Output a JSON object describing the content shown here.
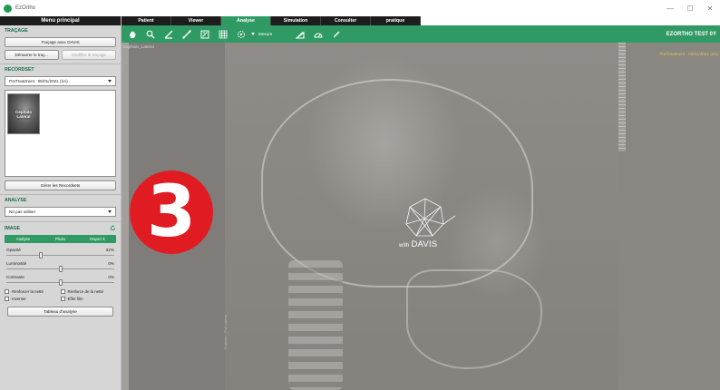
{
  "window": {
    "title": "EzOrtho",
    "controls": [
      "—",
      "☐",
      "✕"
    ]
  },
  "sidebar": {
    "header": "Menu principal",
    "tracage": {
      "title": "TRAÇAGE",
      "davis_button": "Traçage avec DAVIS",
      "start_button": "Démarrer le traç...",
      "modify_button": "Modifier le traçage"
    },
    "recordset": {
      "title": "RECORDSET",
      "selected": "PreTreatment : 05/01/2021 (I/A)",
      "thumbnail_label": "Cephalo Lateral",
      "manage_button": "Gérer les Recordsets"
    },
    "analyse": {
      "title": "ANALYSE",
      "selected": "Ne pas utiliser"
    },
    "image": {
      "title": "IMAGE",
      "segments": [
        "Analyse",
        "Photo",
        "Rayon X"
      ],
      "sliders": [
        {
          "label": "Opacité",
          "value_text": "32%",
          "level": 0.32
        },
        {
          "label": "Luminosité",
          "value_text": "0%",
          "level": 0.5
        },
        {
          "label": "Contraste",
          "value_text": "0%",
          "level": 0.5
        }
      ],
      "checkboxes": [
        "Renforcer la netté",
        "Renforce de la netté",
        "Inverser",
        "Effet film"
      ],
      "table_button": "Tableau d'analyse"
    }
  },
  "tabs": [
    "Patient",
    "Viewer",
    "Analyse",
    "Simulation",
    "Consulter",
    "pratique"
  ],
  "active_tab": "Analyse",
  "toolbar": {
    "icons": [
      "hand-icon",
      "zoom-icon",
      "angle-icon",
      "measure-icon",
      "calibrate-icon",
      "grid-icon",
      "magnet-icon"
    ],
    "mesure_label": "Mesure",
    "right_icons": [
      "ruler-angle-icon",
      "protractor-icon",
      "pen-icon"
    ],
    "patient_name": "EZORTHO TEST 0Y"
  },
  "viewer": {
    "image_label": "Cephalo_Lateral",
    "pretreatment_label": "PreTreatment : 05/01/2021 (I/A)",
    "side_caption": "Cephalo - Full Lateral",
    "watermark_small": "with",
    "watermark_big": "DAVIS",
    "step_number": "3"
  },
  "colors": {
    "accent": "#2f9a63",
    "tab_dark": "#1d1d1d",
    "badge_red": "#e11b22",
    "pretreat_yellow": "#e1cc50"
  }
}
